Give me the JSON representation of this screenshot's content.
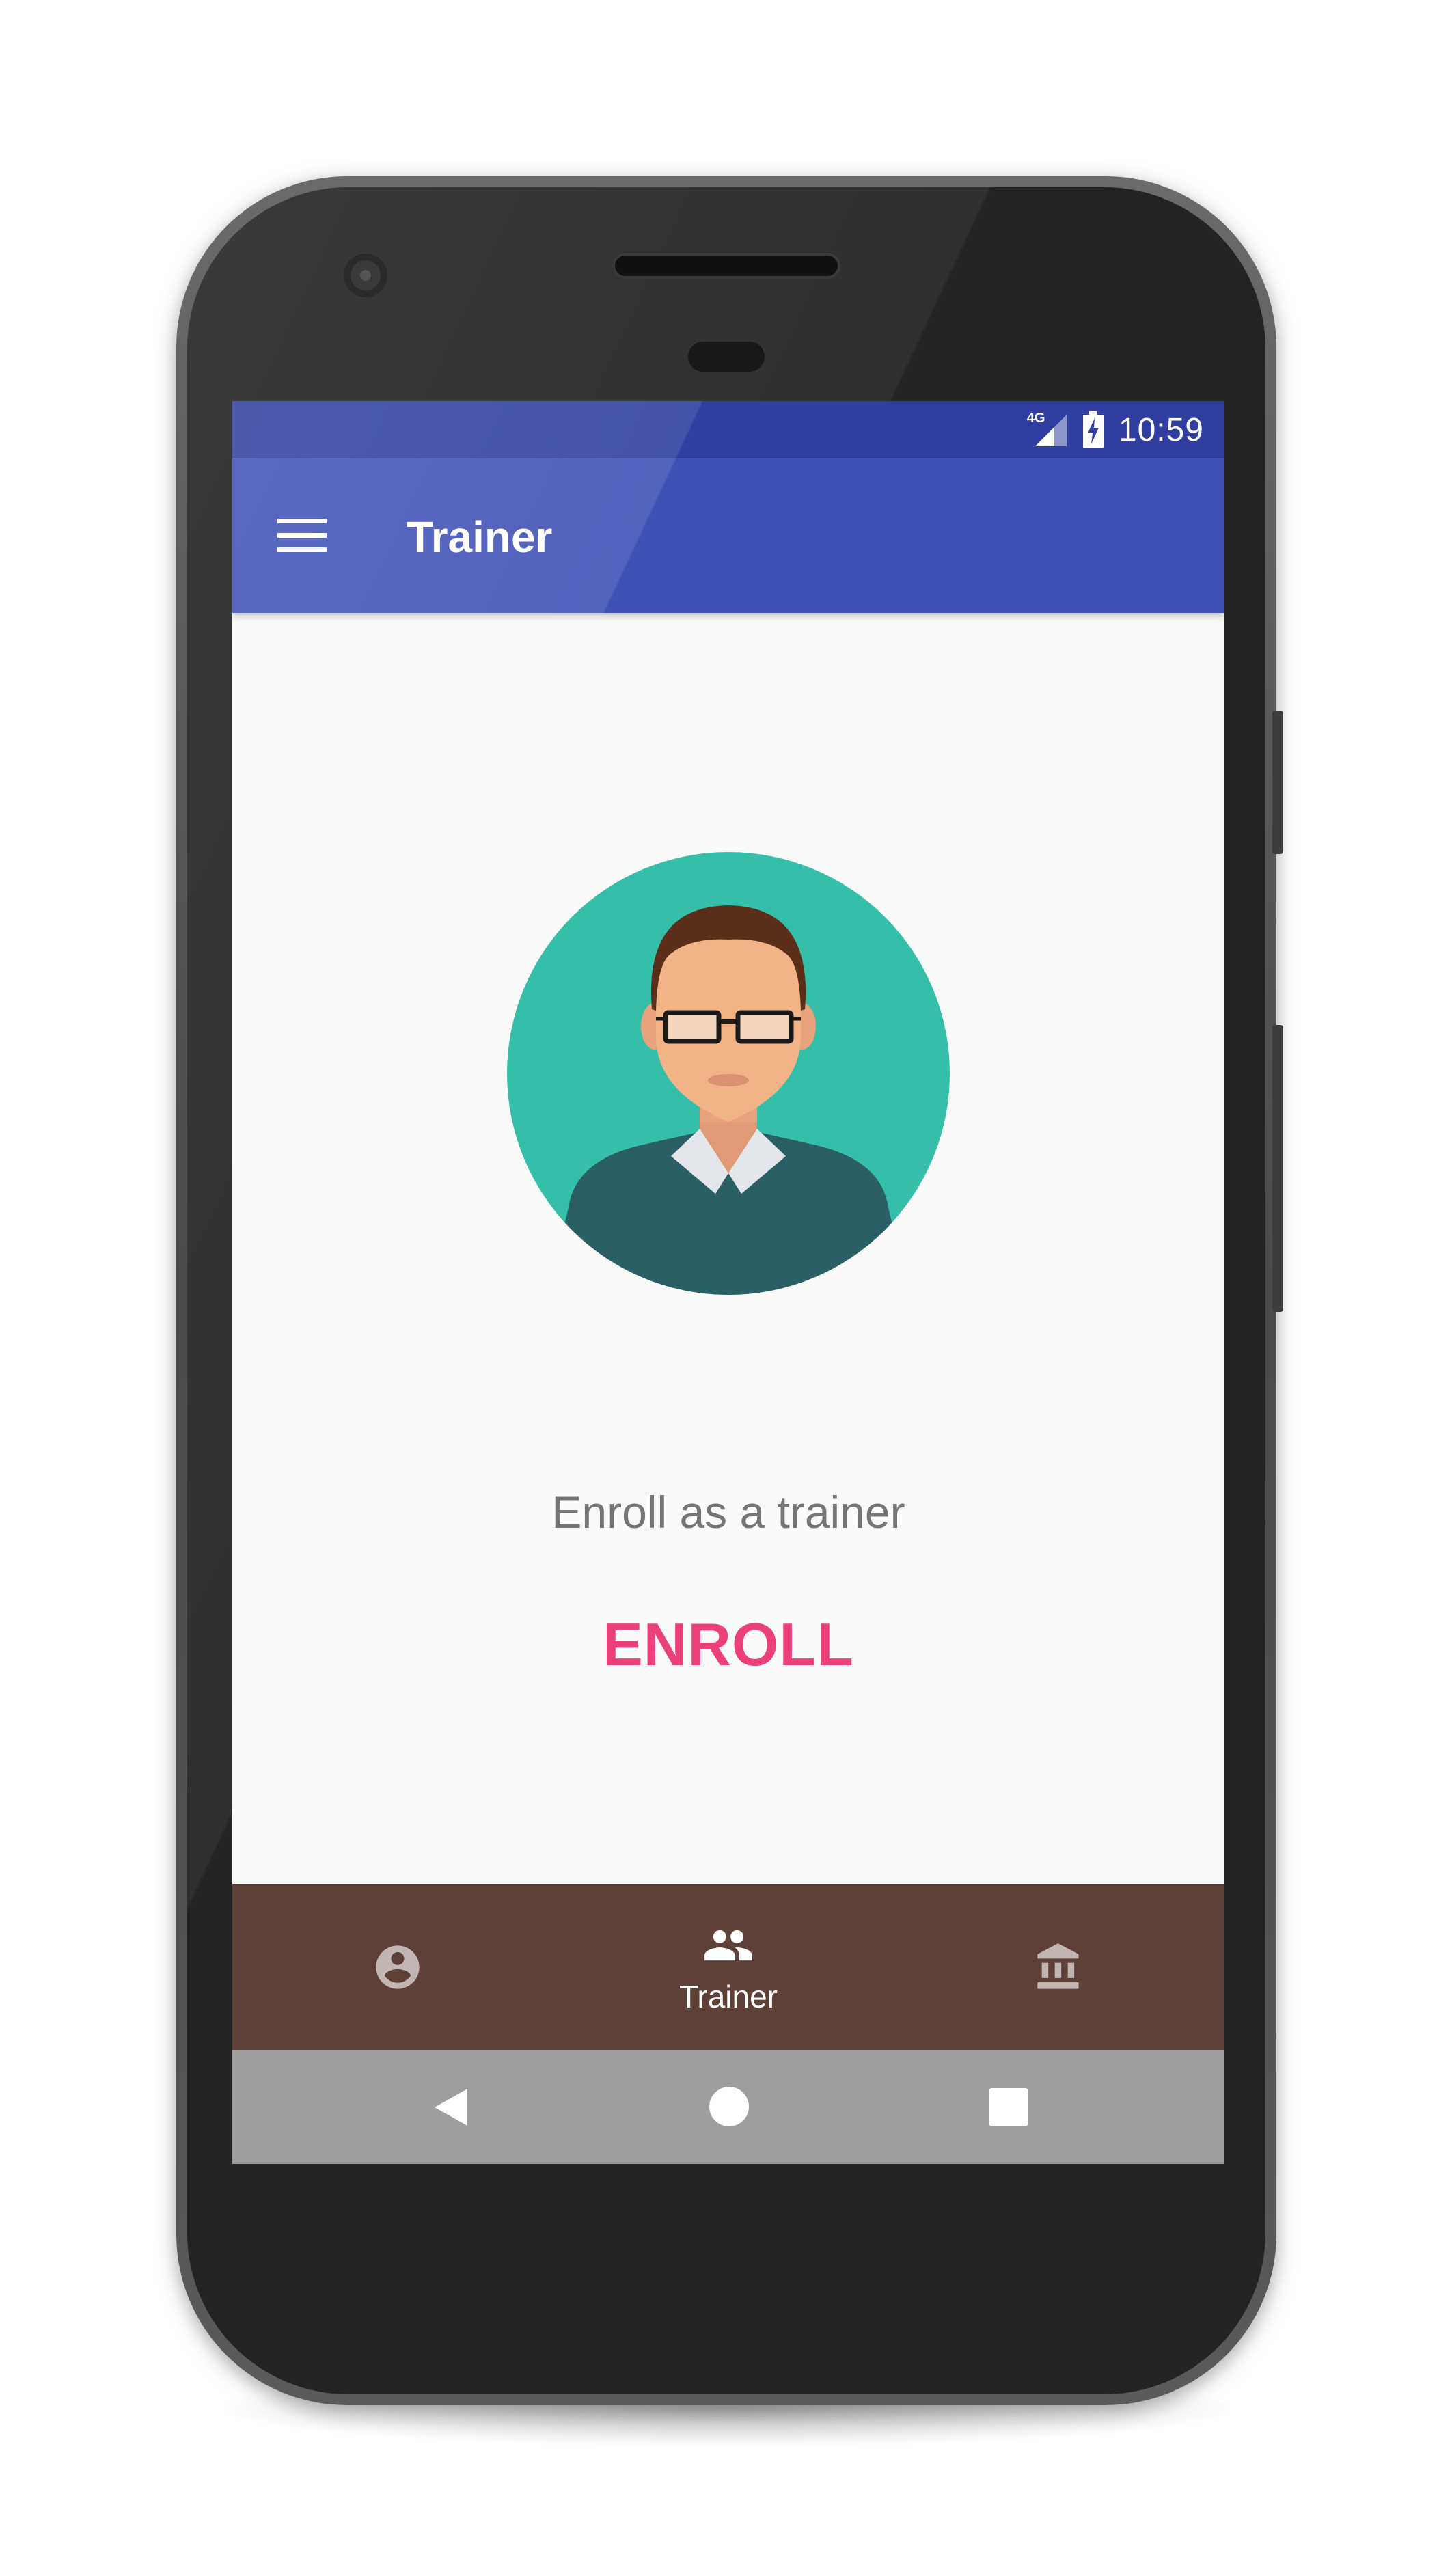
{
  "status_bar": {
    "network": "4G",
    "time": "10:59"
  },
  "app_bar": {
    "menu_icon": "hamburger-menu-icon",
    "title": "Trainer"
  },
  "content": {
    "avatar_icon": "trainer-avatar",
    "prompt": "Enroll as a trainer",
    "enroll_button": "ENROLL"
  },
  "bottom_nav": {
    "items": [
      {
        "icon": "account-circle-icon",
        "label": "",
        "active": false
      },
      {
        "icon": "people-icon",
        "label": "Trainer",
        "active": true
      },
      {
        "icon": "bank-icon",
        "label": "",
        "active": false
      }
    ]
  },
  "system_nav": {
    "back": "back-icon",
    "home": "home-icon",
    "recents": "recents-icon"
  },
  "colors": {
    "primary_dark": "#303f9f",
    "primary": "#3f51b5",
    "accent": "#ec407a",
    "bottom_nav": "#5d4037",
    "avatar_bg": "#35bfa8"
  }
}
